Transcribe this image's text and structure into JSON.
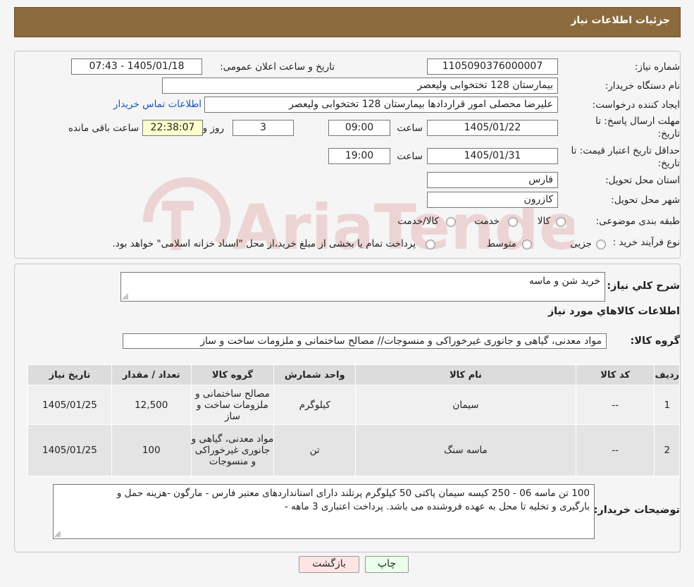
{
  "header": {
    "title": "جزئیات اطلاعات نیاز"
  },
  "info": {
    "need_number": {
      "label": "شماره نیاز:",
      "value": "1105090376000007"
    },
    "announce": {
      "label": "تاریخ و ساعت اعلان عمومی:",
      "value": "1405/01/18 - 07:43"
    },
    "buyer_org": {
      "label": "نام دستگاه خریدار:",
      "value": "بیمارستان 128 تختخوابی ولیعصر"
    },
    "requester": {
      "label": "ایجاد کننده درخواست:",
      "value": "علیرضا محصلی امور قراردادها بیمارستان 128 تختخوابی ولیعصر",
      "contact_link": "اطلاعات تماس خریدار"
    },
    "deadline": {
      "label_line1": "مهلت ارسال پاسخ: تا",
      "label_line2": "تاریخ:",
      "date": "1405/01/22",
      "time_label": "ساعت",
      "time": "09:00",
      "days": "3",
      "days_label": "روز و",
      "remaining": "22:38:07",
      "remaining_label": "ساعت باقی مانده"
    },
    "validity": {
      "label_line1": "حداقل تاریخ اعتبار قیمت: تا",
      "label_line2": "تاریخ:",
      "date": "1405/01/31",
      "time_label": "ساعت",
      "time": "19:00"
    },
    "province": {
      "label": "استان محل تحویل:",
      "value": "فارس"
    },
    "city": {
      "label": "شهر محل تحویل:",
      "value": "کازرون"
    },
    "category": {
      "label": "طبقه بندی موضوعی:",
      "options": [
        "کالا",
        "خدمت",
        "کالا/خدمت"
      ]
    },
    "process": {
      "label": "نوع فرآیند خرید :",
      "options": [
        "جزیی",
        "متوسط"
      ],
      "note": "پرداخت تمام یا بخشی از مبلغ خرید،از محل \"اسناد خزانه اسلامی\" خواهد بود."
    }
  },
  "watermark": {
    "text": "AriaTender.neT"
  },
  "summary": {
    "label": "شرح کلي نياز:",
    "value": "خرید شن و ماسه"
  },
  "goods": {
    "section_title": "اطلاعات کالاهاي مورد نياز",
    "group_label": "گروه کالا:",
    "group_value": "مواد معدنی، گیاهی و جانوری غیرخوراکی و منسوجات// مصالح ساختمانی و ملزومات ساخت و ساز",
    "columns": [
      "رديف",
      "کد کالا",
      "نام کالا",
      "واحد شمارش",
      "گروه کالا",
      "تعداد / مقدار",
      "تاریخ نیاز"
    ],
    "rows": [
      {
        "idx": "1",
        "code": "--",
        "name": "سیمان",
        "unit": "کیلوگرم",
        "group": "مصالح ساختمانی و ملزومات ساخت و ساز",
        "qty": "12,500",
        "date": "1405/01/25"
      },
      {
        "idx": "2",
        "code": "--",
        "name": "ماسه سنگ",
        "unit": "تن",
        "group": "مواد معدنی، گیاهی و جانوری غیرخوراکی و منسوجات",
        "qty": "100",
        "date": "1405/01/25"
      }
    ]
  },
  "buyer_notes": {
    "label": "توضیحات خریدار:",
    "line1": "100 تن ماسه 06 - 250 کیسه سیمان پاکتی 50 کیلوگرم پرتلند دارای استانداردهای معتبر فارس - مارگون -هزینه حمل و",
    "line2": "بارگیری و تخلیه تا محل به عهده فروشنده می باشد. پرداخت اعتباری 3 ماهه -"
  },
  "buttons": {
    "print": "چاپ",
    "back": "بازگشت"
  },
  "colors": {
    "header": "#8b6b3d",
    "link": "#1a57b8",
    "back_button": "#ffe4e4",
    "print_button": "#eaffea",
    "remaining_bg": "#ffffcc"
  }
}
